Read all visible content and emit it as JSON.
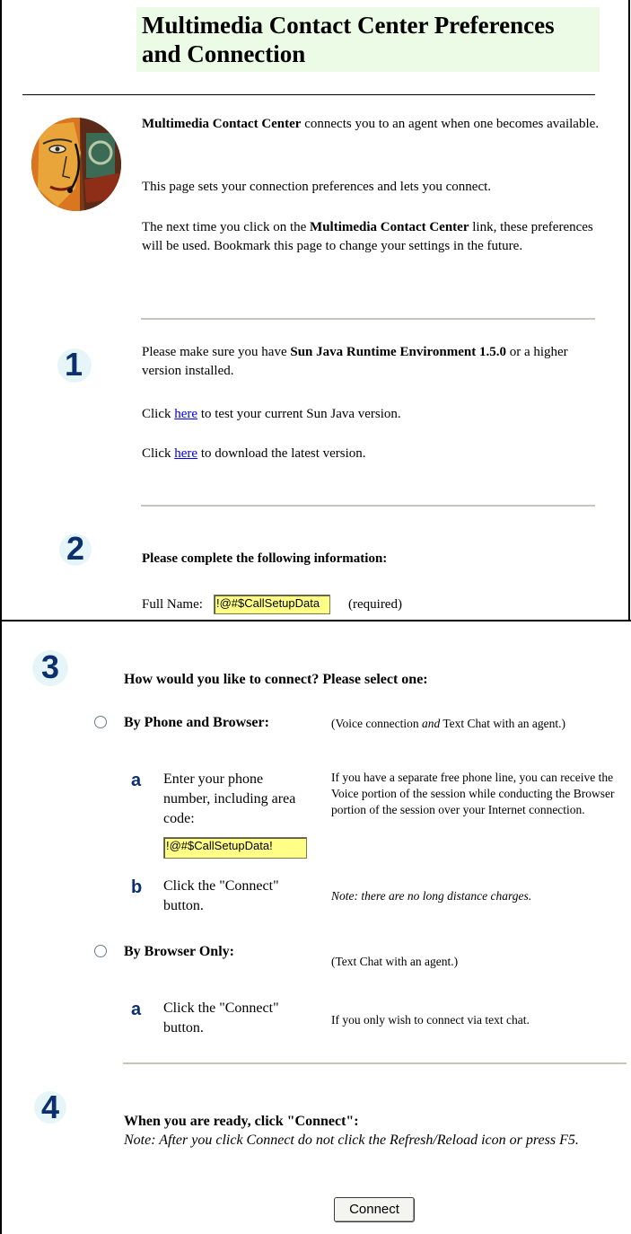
{
  "header": {
    "title": "Multimedia Contact Center Preferences and Connection"
  },
  "intro": {
    "avatar_icon": "agent-headset-portrait-icon",
    "p1_bold": "Multimedia Contact Center",
    "p1_rest": " connects you to an agent when one becomes available.",
    "p2": "This page sets your connection preferences and lets you connect.",
    "p3_pre": "The next time you click on the ",
    "p3_bold": "Multimedia Contact Center",
    "p3_post": " link, these preferences will be used. Bookmark this page to change your settings in the future."
  },
  "step1": {
    "number": "1",
    "text_pre": "Please make sure you have ",
    "text_bold": "Sun Java Runtime Environment 1.5.0",
    "text_post": " or a higher version installed.",
    "test_pre": "Click ",
    "test_link": "here",
    "test_post": " to test your current Sun Java version.",
    "download_pre": "Click ",
    "download_link": "here",
    "download_post": " to download the latest version."
  },
  "step2": {
    "number": "2",
    "heading": "Please complete the following information:",
    "fullname_label": "Full Name:",
    "fullname_value": "!@#$CallSetupData",
    "required_label": "(required)"
  },
  "step3": {
    "number": "3",
    "heading": "How would you like to connect? Please select one:",
    "option1": {
      "label": "By Phone and Browser:",
      "desc_pre": "(Voice connection ",
      "desc_italic": "and",
      "desc_post": " Text Chat with an agent.)",
      "sub_a_letter": "a",
      "sub_a_text": "Enter your phone number, including area code:",
      "phone_value": "!@#$CallSetupData!",
      "sub_a_desc": "If you have a separate free phone line, you can receive the Voice portion of the session while conducting the Browser portion of the session over your Internet connection.",
      "sub_b_letter": "b",
      "sub_b_text": "Click the \"Connect\" button.",
      "sub_b_note": "Note: there are no long distance charges."
    },
    "option2": {
      "label": "By Browser Only:",
      "desc": "(Text Chat with an agent.)",
      "sub_a_letter": "a",
      "sub_a_text": "Click the \"Connect\" button.",
      "sub_a_desc": "If you only wish to connect via text chat."
    }
  },
  "step4": {
    "number": "4",
    "heading": "When you are ready, click \"Connect\":",
    "note": "Note: After you click Connect do not click the Refresh/Reload icon or press F5.",
    "connect_label": "Connect"
  }
}
